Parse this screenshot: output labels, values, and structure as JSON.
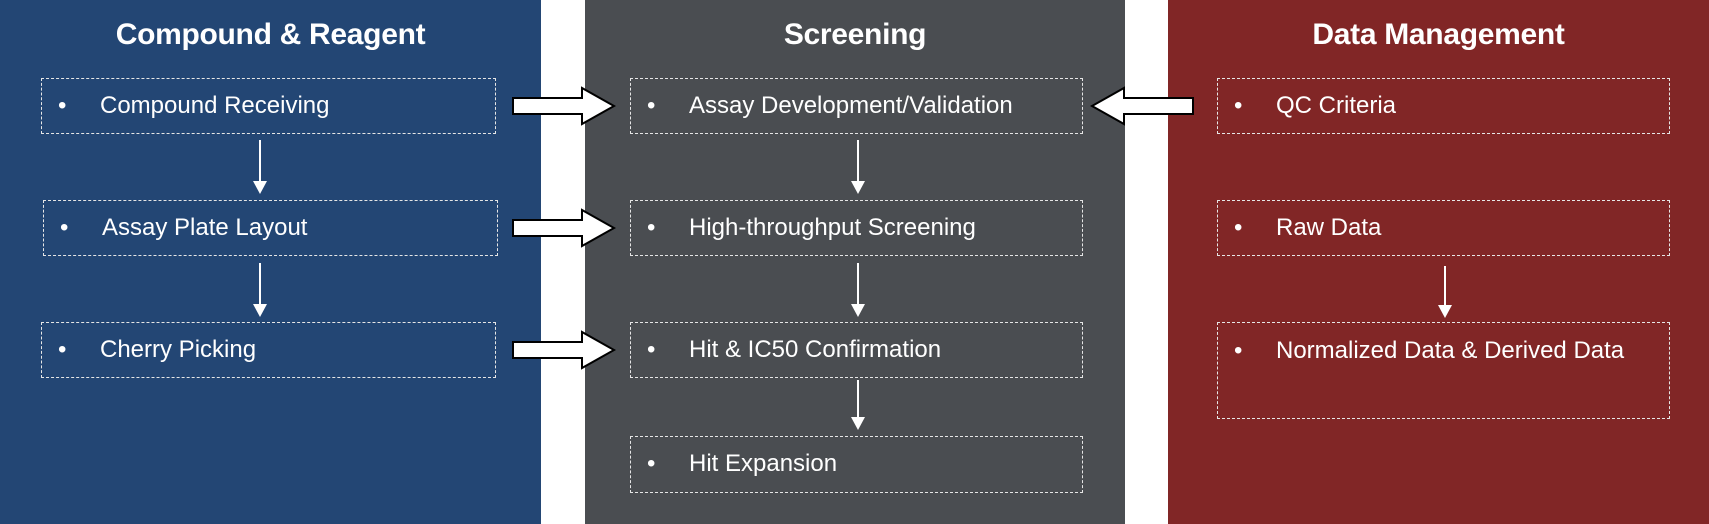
{
  "colors": {
    "compound": "#234674",
    "screening": "#4a4d51",
    "data": "#812626"
  },
  "columns": [
    {
      "title": "Compound & Reagent",
      "items": [
        "Compound Receiving",
        "Assay Plate Layout",
        "Cherry Picking"
      ]
    },
    {
      "title": "Screening",
      "items": [
        "Assay Development/Validation",
        "High-throughput Screening",
        "Hit & IC50 Confirmation",
        "Hit Expansion"
      ]
    },
    {
      "title": "Data Management",
      "items": [
        "QC Criteria",
        "Raw Data",
        "Normalized Data & Derived Data"
      ]
    }
  ],
  "bullet": "•"
}
